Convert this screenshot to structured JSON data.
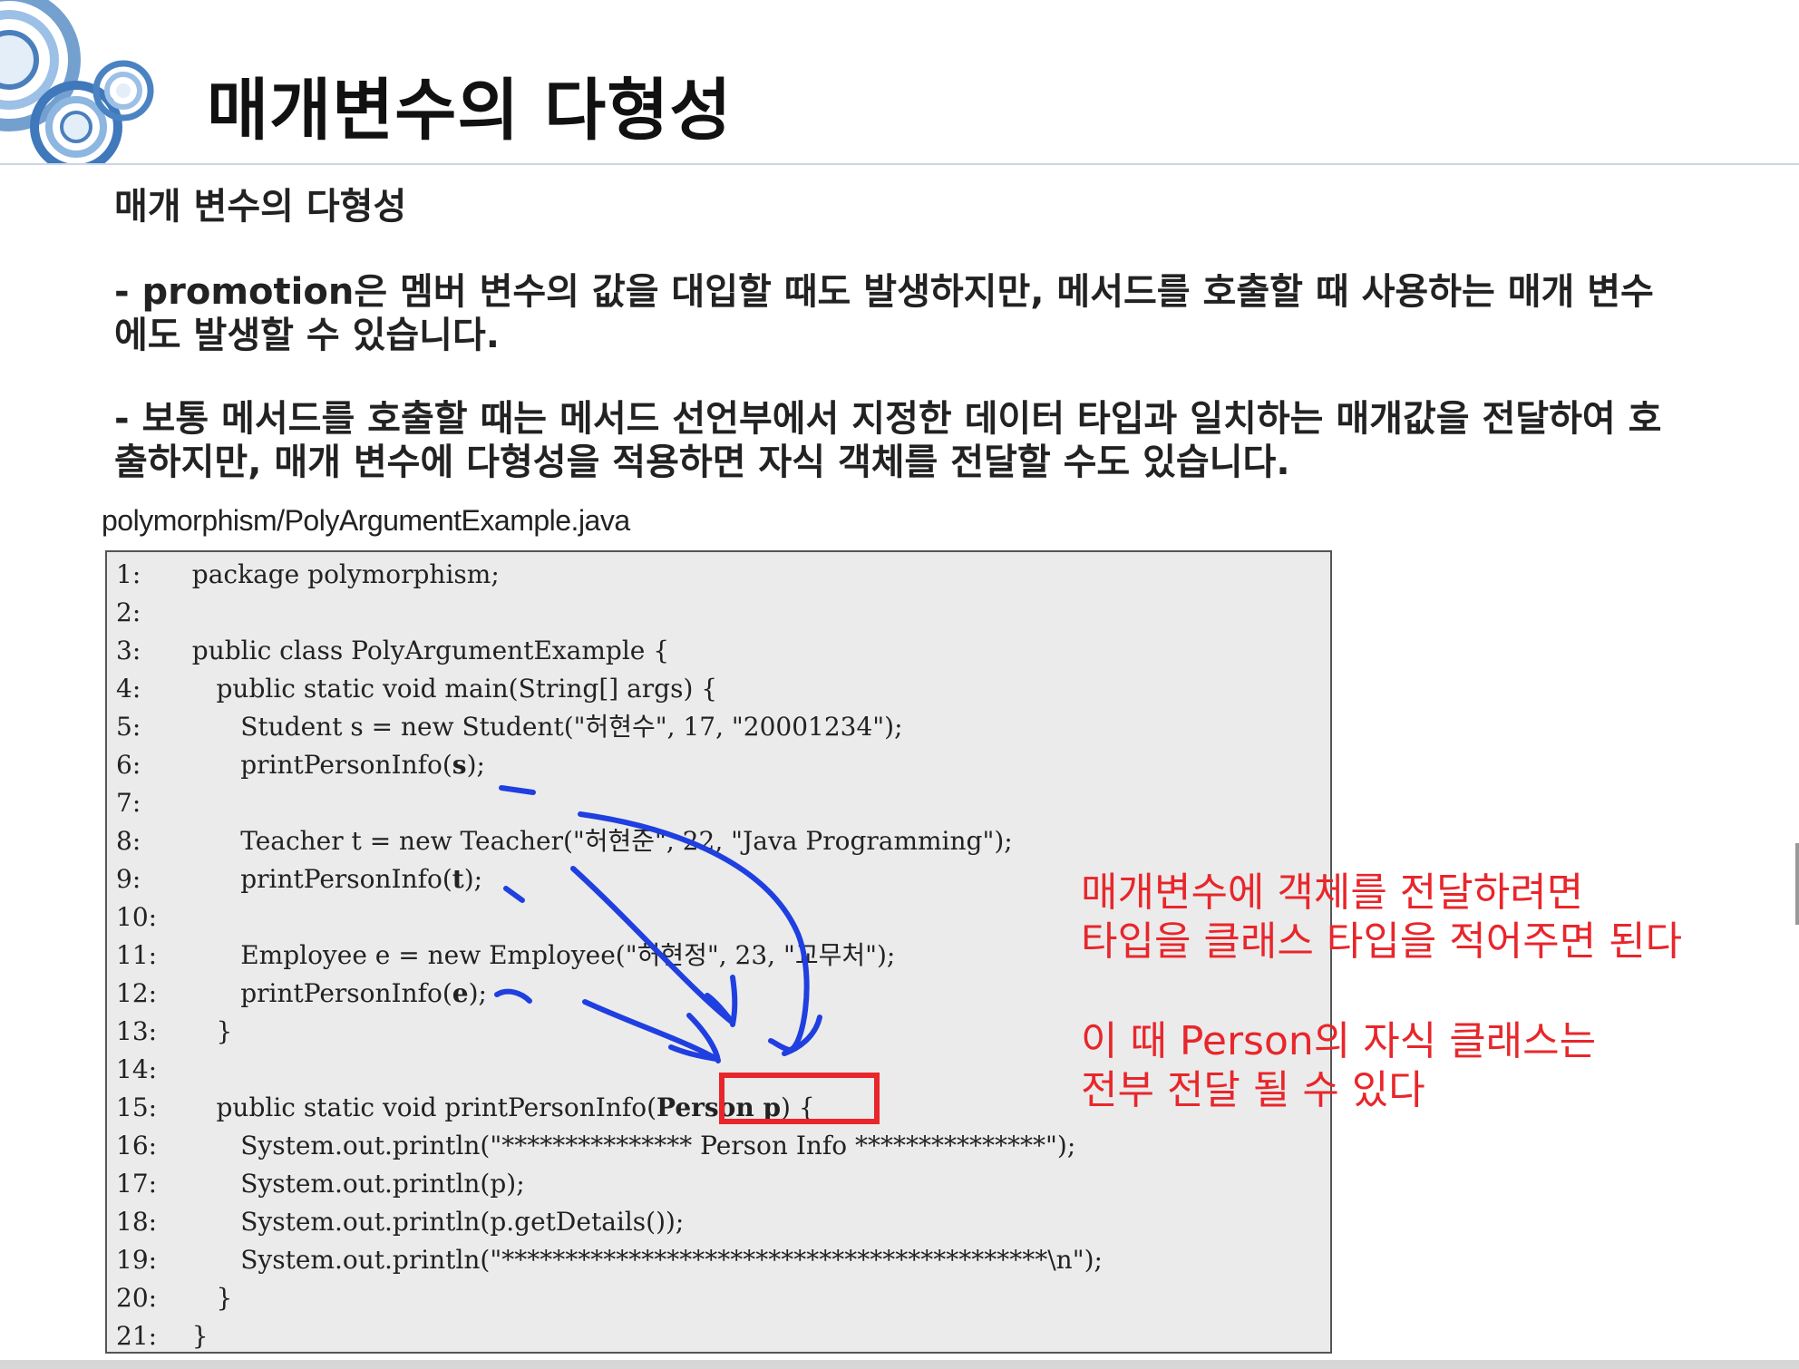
{
  "header": {
    "title": "매개변수의 다형성"
  },
  "content": {
    "subtitle": "매개 변수의 다형성",
    "para1": "- promotion은 멤버 변수의 값을 대입할 때도 발생하지만, 메서드를 호출할 때 사용하는 매개 변수에도 발생할 수 있습니다.",
    "para2": "- 보통 메서드를 호출할 때는 메서드 선언부에서 지정한 데이터 타입과 일치하는 매개값을 전달하여 호출하지만, 매개 변수에 다형성을 적용하면 자식 객체를 전달할 수도 있습니다."
  },
  "code": {
    "filename": "polymorphism/PolyArgumentExample.java",
    "lines": [
      {
        "num": "1:",
        "pre": "  package polymorphism;",
        "bold": "",
        "post": ""
      },
      {
        "num": "2:",
        "pre": "",
        "bold": "",
        "post": ""
      },
      {
        "num": "3:",
        "pre": "  public class PolyArgumentExample {",
        "bold": "",
        "post": ""
      },
      {
        "num": "4:",
        "pre": "     public static void main(String[] args) {",
        "bold": "",
        "post": ""
      },
      {
        "num": "5:",
        "pre": "        Student s = new Student(\"허현수\", 17, \"20001234\");",
        "bold": "",
        "post": ""
      },
      {
        "num": "6:",
        "pre": "        printPersonInfo(",
        "bold": "s",
        "post": ");"
      },
      {
        "num": "7:",
        "pre": "",
        "bold": "",
        "post": ""
      },
      {
        "num": "8:",
        "pre": "        Teacher t = new Teacher(\"허현준\", 22, \"Java Programming\");",
        "bold": "",
        "post": ""
      },
      {
        "num": "9:",
        "pre": "        printPersonInfo(",
        "bold": "t",
        "post": ");"
      },
      {
        "num": "10:",
        "pre": "",
        "bold": "",
        "post": ""
      },
      {
        "num": "11:",
        "pre": "        Employee e = new Employee(\"허현정\", 23, \"교무처\");",
        "bold": "",
        "post": ""
      },
      {
        "num": "12:",
        "pre": "        printPersonInfo(",
        "bold": "e",
        "post": ");"
      },
      {
        "num": "13:",
        "pre": "     }",
        "bold": "",
        "post": ""
      },
      {
        "num": "14:",
        "pre": "",
        "bold": "",
        "post": ""
      },
      {
        "num": "15:",
        "pre": "     public static void printPersonInfo(",
        "bold": "Person p",
        "post": ") {"
      },
      {
        "num": "16:",
        "pre": "        System.out.println(\"*************** Person Info ***************\");",
        "bold": "",
        "post": ""
      },
      {
        "num": "17:",
        "pre": "        System.out.println(p);",
        "bold": "",
        "post": ""
      },
      {
        "num": "18:",
        "pre": "        System.out.println(p.getDetails());",
        "bold": "",
        "post": ""
      },
      {
        "num": "19:",
        "pre": "        System.out.println(\"*******************************************\\n\");",
        "bold": "",
        "post": ""
      },
      {
        "num": "20:",
        "pre": "     }",
        "bold": "",
        "post": ""
      },
      {
        "num": "21:",
        "pre": "  }",
        "bold": "",
        "post": ""
      }
    ]
  },
  "annotations": {
    "note1": "매개변수에 객체를 전달하려면\n타입을 클래스 타입을 적어주면 된다",
    "note2": "이 때 Person의 자식 클래스는\n전부 전달 될 수 있다"
  },
  "colors": {
    "annotation": "#e8262b",
    "arrows": "#1f3fe0",
    "code_background": "#ebebeb"
  }
}
